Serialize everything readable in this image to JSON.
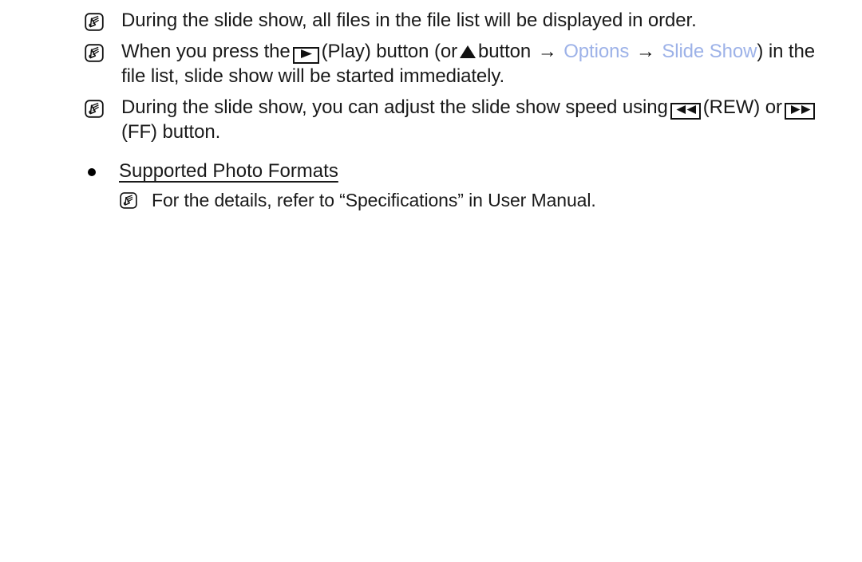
{
  "document": {
    "type": "tv-user-manual-page",
    "background_color": "#ffffff",
    "text_color": "#1a1a1a",
    "accent_color": "#9DB2E8"
  },
  "notes": [
    {
      "icon": "note-pencil-icon",
      "text": "During the slide show, all files in the file list will be displayed in order."
    },
    {
      "icon": "note-pencil-icon",
      "segments": {
        "a": "When you press the",
        "play_icon": "play-button-icon",
        "b": "(Play) button (or",
        "up_icon": "up-arrow-button-icon",
        "c": "button",
        "arrow1": "→",
        "menu1": "Options",
        "arrow2": "→",
        "menu2": "Slide Show",
        "d": ") in the file list, slide show will be started immediately."
      }
    },
    {
      "icon": "note-pencil-icon",
      "segments": {
        "a": "During the slide show, you can adjust the slide show speed using",
        "rew_icon": "rewind-button-icon",
        "b": "(REW) or",
        "ff_icon": "fast-forward-button-icon",
        "c": "(FF) button."
      }
    }
  ],
  "section": {
    "bullet": "●",
    "title": "Supported Photo Formats",
    "note": {
      "icon": "note-pencil-icon",
      "text": "For the details, refer to “Specifications” in User Manual."
    }
  },
  "labels": {
    "menu_options": "Options",
    "menu_slide": "Slide",
    "menu_show": "Show",
    "arrow": "→",
    "line1": "During the slide show, all files in the file list will be displayed in order.",
    "line2_a": "When you press the",
    "line2_b": "(Play) button (or",
    "line2_c": "button",
    "line2_d": ") in the file list, slide show will be started immediately.",
    "line3_a": "During the slide show, you can adjust the slide show speed using",
    "line3_b": "(REW) or",
    "line3_c": "(FF) button.",
    "section_title": "Supported Photo Formats",
    "section_note": "For the details, refer to “Specifications” in User Manual."
  }
}
